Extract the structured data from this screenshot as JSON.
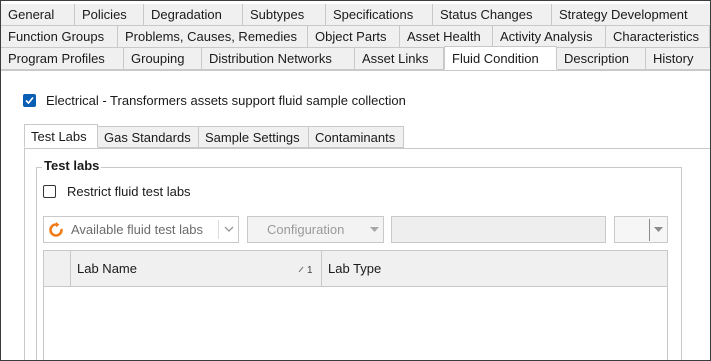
{
  "tabs": {
    "row1": [
      "General",
      "Policies",
      "Degradation",
      "Subtypes",
      "Specifications",
      "Status Changes",
      "Strategy Development"
    ],
    "row2": [
      "Function Groups",
      "Problems, Causes, Remedies",
      "Object Parts",
      "Asset Health",
      "Activity Analysis",
      "Characteristics"
    ],
    "row3": [
      "Program Profiles",
      "Grouping",
      "Distribution Networks",
      "Asset Links",
      "Fluid Condition",
      "Description",
      "History"
    ],
    "active": "Fluid Condition"
  },
  "fluid_sample": {
    "label": "Electrical - Transformers assets support fluid sample collection",
    "checked": true
  },
  "inner_tabs": [
    "Test Labs",
    "Gas Standards",
    "Sample Settings",
    "Contaminants"
  ],
  "inner_active": "Test Labs",
  "test_labs": {
    "group_title": "Test labs",
    "restrict_label": "Restrict fluid test labs",
    "restrict_checked": false,
    "available_combo": "Available fluid test labs",
    "configuration_combo": "Configuration",
    "columns": {
      "lab_name": "Lab Name",
      "sort_indicator": "1",
      "lab_type": "Lab Type"
    }
  },
  "colors": {
    "accent": "#0a5fb4",
    "orange_icon": "#f07c1a"
  }
}
